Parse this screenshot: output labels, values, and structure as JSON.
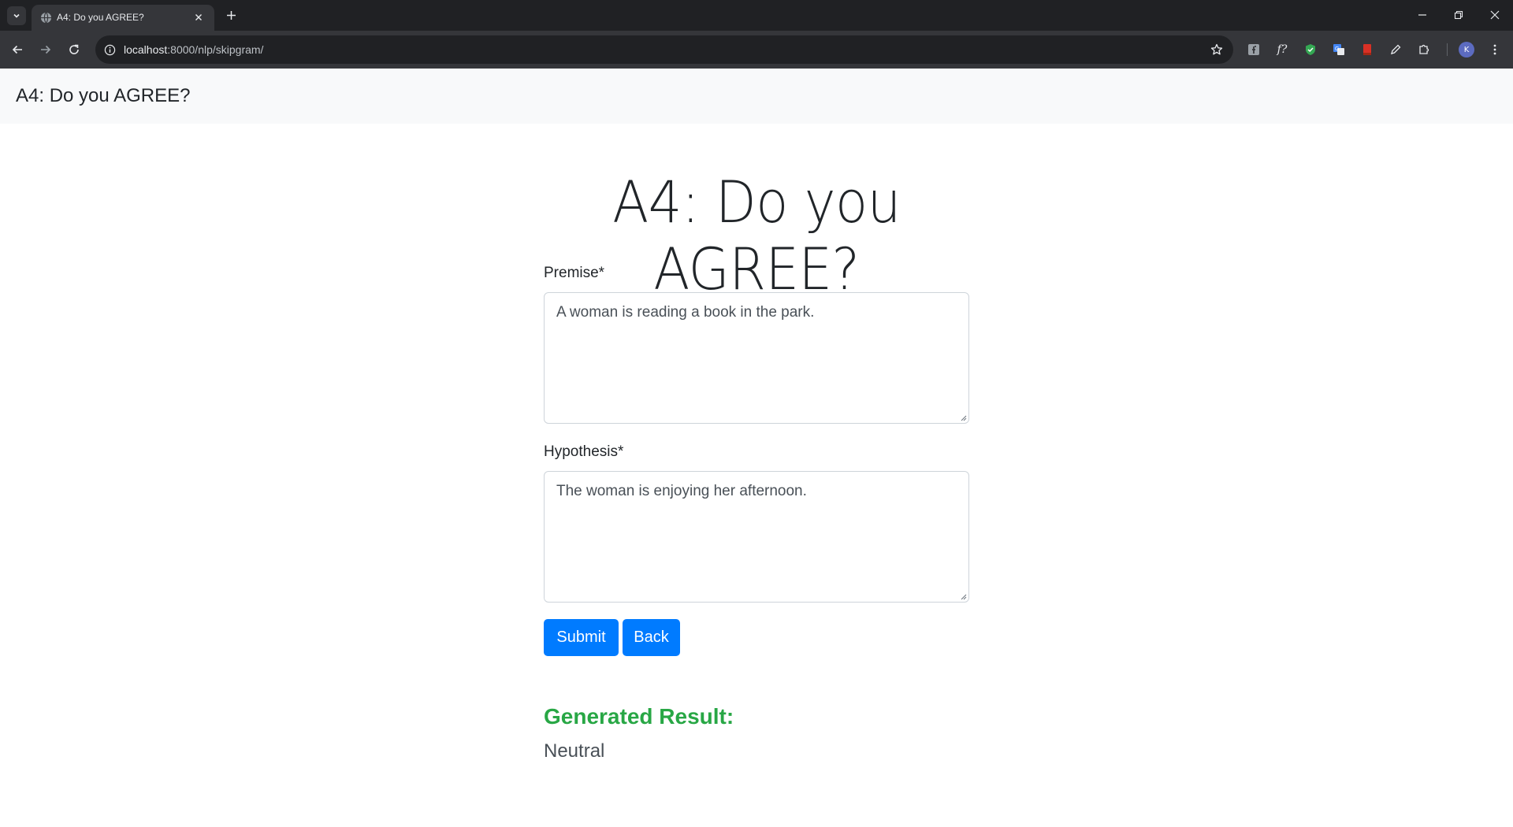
{
  "browser": {
    "tab_title": "A4: Do you AGREE?",
    "url_host": "localhost",
    "url_path": ":8000/nlp/skipgram/",
    "profile_initial": "K"
  },
  "navbar": {
    "brand": "A4: Do you AGREE?"
  },
  "main": {
    "heading": "A4: Do you AGREE?",
    "premise_label": "Premise*",
    "premise_value": "A woman is reading a book in the park.",
    "hypothesis_label": "Hypothesis*",
    "hypothesis_value": "The woman is enjoying her afternoon.",
    "submit_label": "Submit",
    "back_label": "Back",
    "result_title": "Generated Result:",
    "result_value": "Neutral"
  },
  "colors": {
    "primary": "#007bff",
    "success": "#28a745",
    "navbar_bg": "#f8f9fa",
    "chrome_dark": "#202124",
    "chrome_toolbar": "#35363a"
  },
  "icons": [
    "tab-list-icon",
    "globe-icon",
    "close-icon",
    "plus-icon",
    "minimize-icon",
    "restore-icon",
    "back-arrow-icon",
    "forward-arrow-icon",
    "reload-icon",
    "info-icon",
    "star-icon",
    "extension-icon",
    "pen-icon",
    "puzzle-icon"
  ]
}
